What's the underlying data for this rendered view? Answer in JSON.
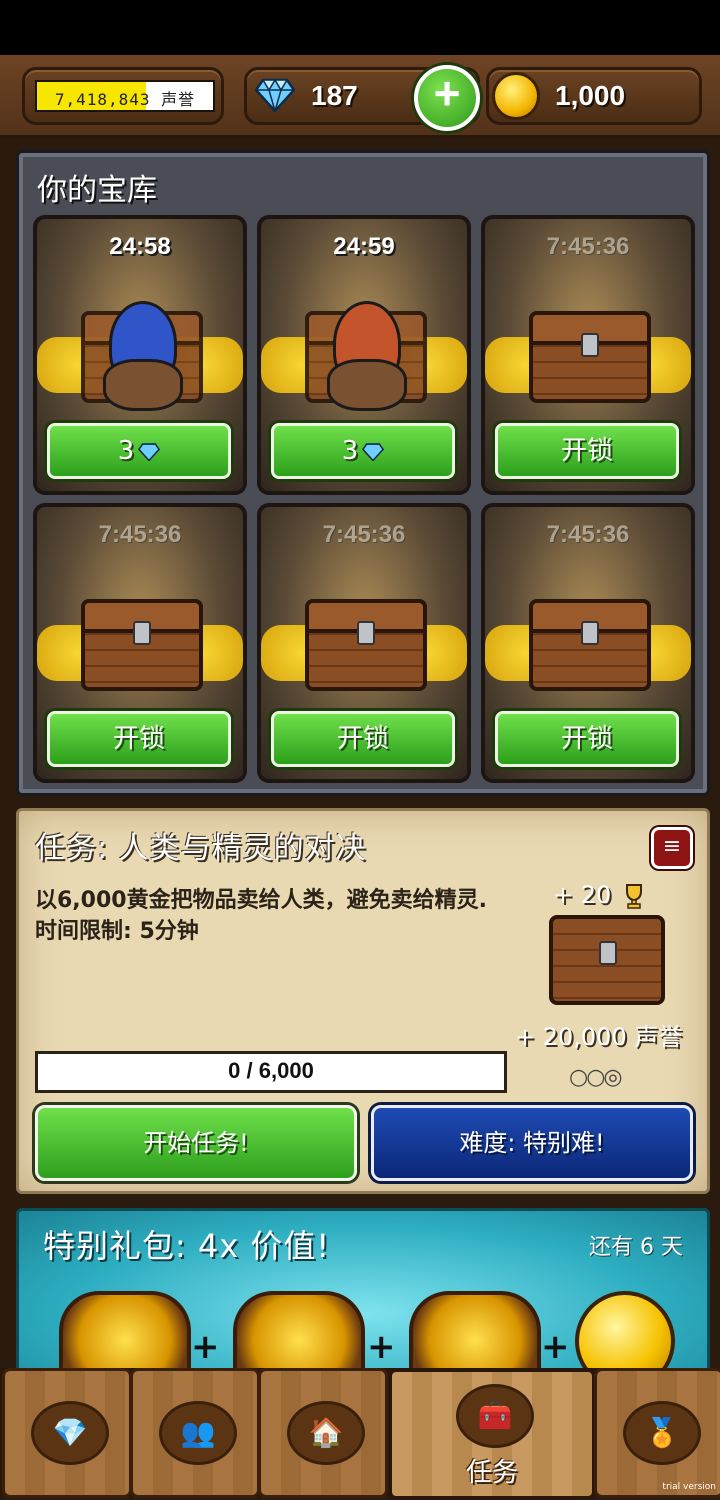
{
  "resources": {
    "reputation": "7,418,843 声誉",
    "reputation_progress": 0.62,
    "gems": "187",
    "coins": "1,000"
  },
  "vault": {
    "title": "你的宝库",
    "slots": [
      {
        "timer": "24:58",
        "button": "3",
        "state": "opening",
        "hood_color": "#2f55c9"
      },
      {
        "timer": "24:59",
        "button": "3",
        "state": "opening",
        "hood_color": "#c4542b"
      },
      {
        "timer": "7:45:36",
        "button": "开锁",
        "state": "locked"
      },
      {
        "timer": "7:45:36",
        "button": "开锁",
        "state": "locked"
      },
      {
        "timer": "7:45:36",
        "button": "开锁",
        "state": "locked"
      },
      {
        "timer": "7:45:36",
        "button": "开锁",
        "state": "locked"
      }
    ]
  },
  "quest": {
    "title": "任务: 人类与精灵的对决",
    "close_label": "≡",
    "description": "以6,000黄金把物品卖给人类，避免卖给精灵. 时间限制: 5分钟",
    "reward_trophies": "+ 20",
    "reward_reputation": "+ 20,000 声誉",
    "difficulty_dots": "○○◎",
    "progress": "0 / 6,000",
    "start_label": "开始任务!",
    "difficulty_label": "难度: 特别难!"
  },
  "offer": {
    "title": "特别礼包:  4x 价值!",
    "timer": "还有 6 天"
  },
  "nav": {
    "tabs": [
      {
        "icon": "diamond-icon",
        "label": ""
      },
      {
        "icon": "people-icon",
        "label": ""
      },
      {
        "icon": "house-icon",
        "label": ""
      },
      {
        "icon": "chest-icon",
        "label": "任务",
        "active": true
      },
      {
        "icon": "medal-icon",
        "label": ""
      }
    ]
  },
  "watermark": "trial version"
}
